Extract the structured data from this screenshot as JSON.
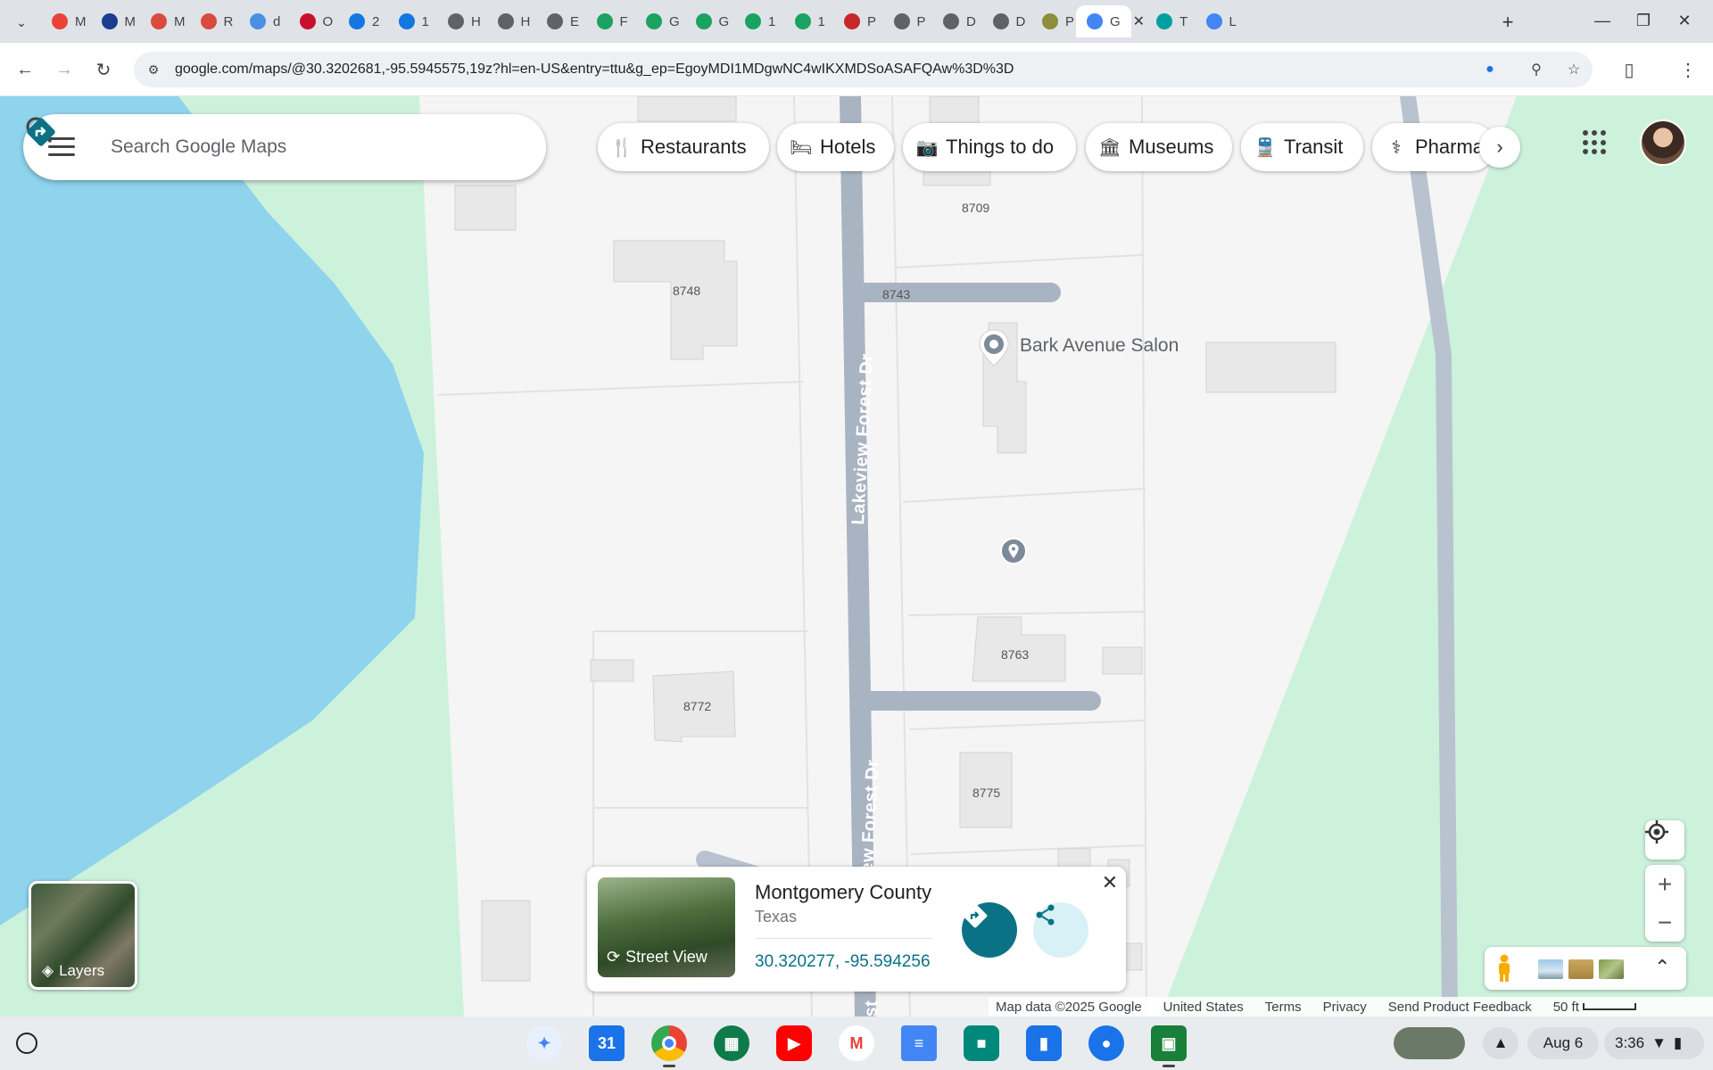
{
  "browser": {
    "tabs": [
      {
        "letter": "M",
        "icon": "gmail-icon",
        "color": "#ea4335"
      },
      {
        "letter": "M",
        "icon": "har-icon",
        "color": "#1a3d8f"
      },
      {
        "letter": "M",
        "icon": "cube-icon",
        "color": "#d94b3c"
      },
      {
        "letter": "R",
        "icon": "cube-icon",
        "color": "#d94b3c"
      },
      {
        "letter": "d",
        "icon": "circle-icon",
        "color": "#4a90e2"
      },
      {
        "letter": "O",
        "icon": "kw-icon",
        "color": "#c8102e"
      },
      {
        "letter": "2",
        "icon": "zillow-icon",
        "color": "#1277e1"
      },
      {
        "letter": "1",
        "icon": "zillow-icon",
        "color": "#1277e1"
      },
      {
        "letter": "H",
        "icon": "globe-icon",
        "color": "#5f6368"
      },
      {
        "letter": "H",
        "icon": "globe-icon",
        "color": "#5f6368"
      },
      {
        "letter": "E",
        "icon": "fingerprint-icon",
        "color": "#5f6368"
      },
      {
        "letter": "F",
        "icon": "leaf-icon",
        "color": "#1aa260"
      },
      {
        "letter": "G",
        "icon": "leaf-icon",
        "color": "#1aa260"
      },
      {
        "letter": "G",
        "icon": "leaf-icon",
        "color": "#1aa260"
      },
      {
        "letter": "1",
        "icon": "leaf-icon",
        "color": "#1aa260"
      },
      {
        "letter": "1",
        "icon": "leaf-icon",
        "color": "#1aa260"
      },
      {
        "letter": "P",
        "icon": "search-doc-icon",
        "color": "#c62828"
      },
      {
        "letter": "P",
        "icon": "globe-icon",
        "color": "#5f6368"
      },
      {
        "letter": "D",
        "icon": "globe-icon",
        "color": "#5f6368"
      },
      {
        "letter": "D",
        "icon": "globe-icon",
        "color": "#5f6368"
      },
      {
        "letter": "P",
        "icon": "seal-icon",
        "color": "#8d8d3a"
      },
      {
        "letter": "G",
        "icon": "google-icon",
        "color": "#4285f4",
        "active": true
      },
      {
        "letter": "T",
        "icon": "tp-icon",
        "color": "#00a0a0"
      },
      {
        "letter": "L",
        "icon": "google-icon",
        "color": "#4285f4"
      }
    ],
    "url": "google.com/maps/@30.3202681,-95.5945575,19z?hl=en-US&entry=ttu&g_ep=EgoyMDI1MDgwNC4wIKXMDSoASAFQAw%3D%3D"
  },
  "maps": {
    "search_placeholder": "Search Google Maps",
    "chips": [
      {
        "label": "Restaurants",
        "icon": "fork-knife-icon"
      },
      {
        "label": "Hotels",
        "icon": "bed-icon"
      },
      {
        "label": "Things to do",
        "icon": "camera-icon"
      },
      {
        "label": "Museums",
        "icon": "museum-icon"
      },
      {
        "label": "Transit",
        "icon": "train-icon"
      },
      {
        "label": "Pharma",
        "icon": "pharmacy-icon"
      }
    ],
    "street_name": "Lakeview Forest Dr",
    "street_name_lower": "ew Forest Dr",
    "street_name_bottom": "st",
    "poi_label": "Bark Avenue Salon",
    "building_numbers": [
      "8709",
      "8748",
      "8743",
      "8763",
      "8772",
      "8775"
    ],
    "layers_label": "Layers",
    "card": {
      "title": "Montgomery County",
      "subtitle": "Texas",
      "coordinates": "30.320277, -95.594256",
      "street_view_label": "Street View"
    },
    "footer": {
      "map_data": "Map data ©2025 Google",
      "country": "United States",
      "terms": "Terms",
      "privacy": "Privacy",
      "feedback": "Send Product Feedback",
      "scale": "50 ft"
    },
    "colors": {
      "water": "#8fd3ec",
      "park": "#cdf2dc",
      "land": "#f5f5f5",
      "road": "#a9b4c2",
      "accent": "#0b7285"
    }
  },
  "shelf": {
    "date": "Aug 6",
    "time": "3:36"
  }
}
